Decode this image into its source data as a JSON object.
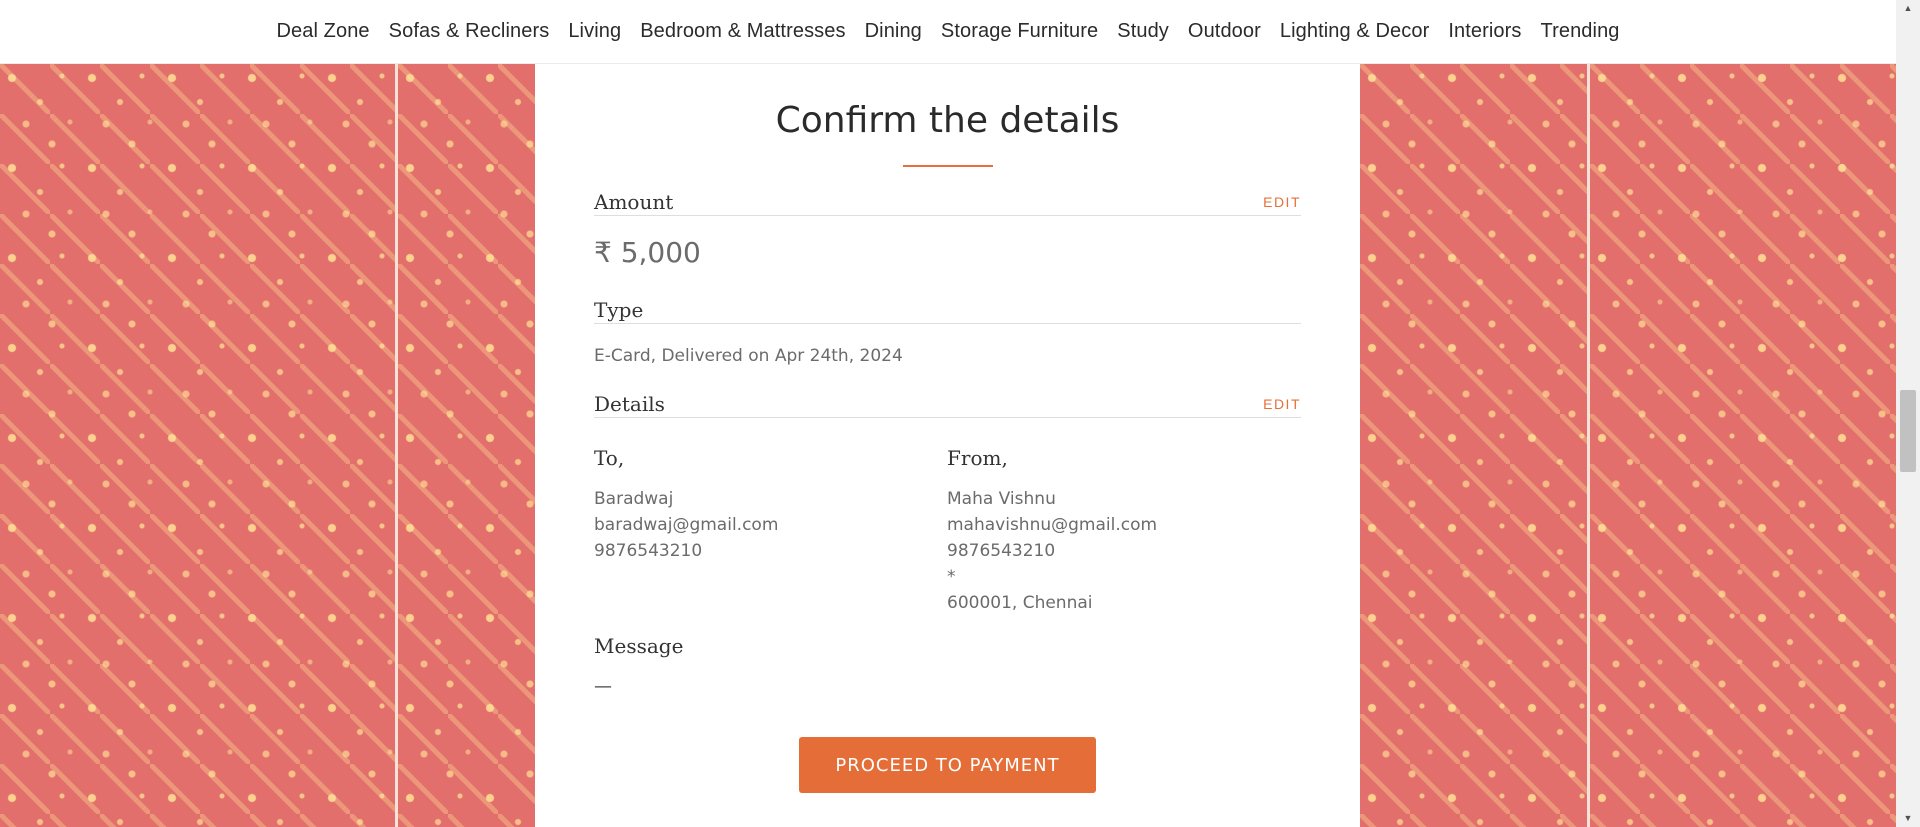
{
  "nav": {
    "items": [
      "Deal Zone",
      "Sofas & Recliners",
      "Living",
      "Bedroom & Mattresses",
      "Dining",
      "Storage Furniture",
      "Study",
      "Outdoor",
      "Lighting & Decor",
      "Interiors",
      "Trending"
    ]
  },
  "confirm": {
    "title": "Confirm the details",
    "amount_label": "Amount",
    "amount_edit": "EDIT",
    "amount_value": "₹ 5,000",
    "type_label": "Type",
    "type_value": "E-Card, Delivered on Apr 24th, 2024",
    "details_label": "Details",
    "details_edit": "EDIT",
    "to": {
      "label": "To,",
      "name": "Baradwaj",
      "email": "baradwaj@gmail.com",
      "phone": "9876543210"
    },
    "from": {
      "label": "From,",
      "name": "Maha Vishnu",
      "email": "mahavishnu@gmail.com",
      "phone": "9876543210",
      "address": "*",
      "city": "600001, Chennai"
    },
    "message_label": "Message",
    "message_value": "—",
    "proceed_label": "PROCEED TO PAYMENT"
  },
  "colors": {
    "accent": "#e56d38",
    "pattern_bg": "#e36f6c",
    "pattern_motif": "#ffe296"
  },
  "scrollbar": {
    "up_icon": "▲",
    "down_icon": "▼"
  }
}
